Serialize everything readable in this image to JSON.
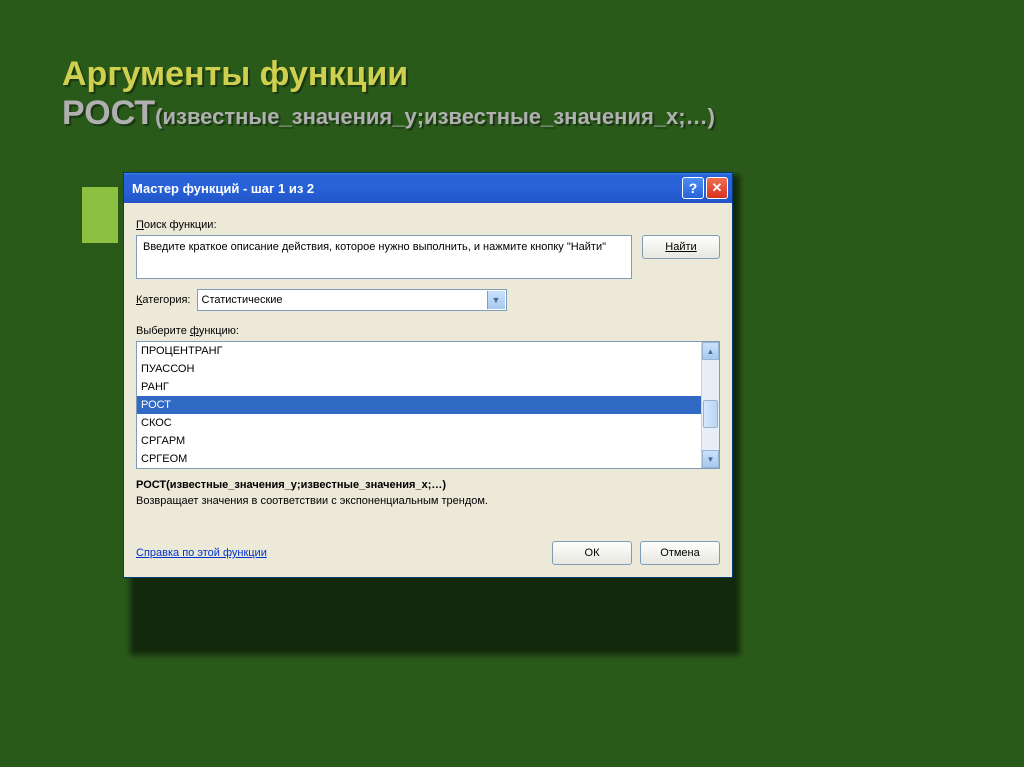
{
  "slide": {
    "title_line1": "Аргументы функции",
    "title_fn": "РОСТ",
    "title_args": "(известные_значения_y;известные_значения_x;…)"
  },
  "dialog": {
    "title": "Мастер функций - шаг 1 из 2",
    "search_label": "Поиск функции:",
    "search_text": "Введите краткое описание действия, которое нужно выполнить, и нажмите кнопку \"Найти\"",
    "find_btn": "Найти",
    "category_label": "Категория:",
    "category_value": "Статистические",
    "select_label": "Выберите функцию:",
    "functions": [
      "ПРОЦЕНТРАНГ",
      "ПУАССОН",
      "РАНГ",
      "РОСТ",
      "СКОС",
      "СРГАРМ",
      "СРГЕОМ"
    ],
    "selected_index": 3,
    "signature": "РОСТ(известные_значения_y;известные_значения_x;…)",
    "description": "Возвращает значения в соответствии с экспоненциальным трендом.",
    "help_link": "Справка по этой функции",
    "ok": "ОК",
    "cancel": "Отмена"
  }
}
